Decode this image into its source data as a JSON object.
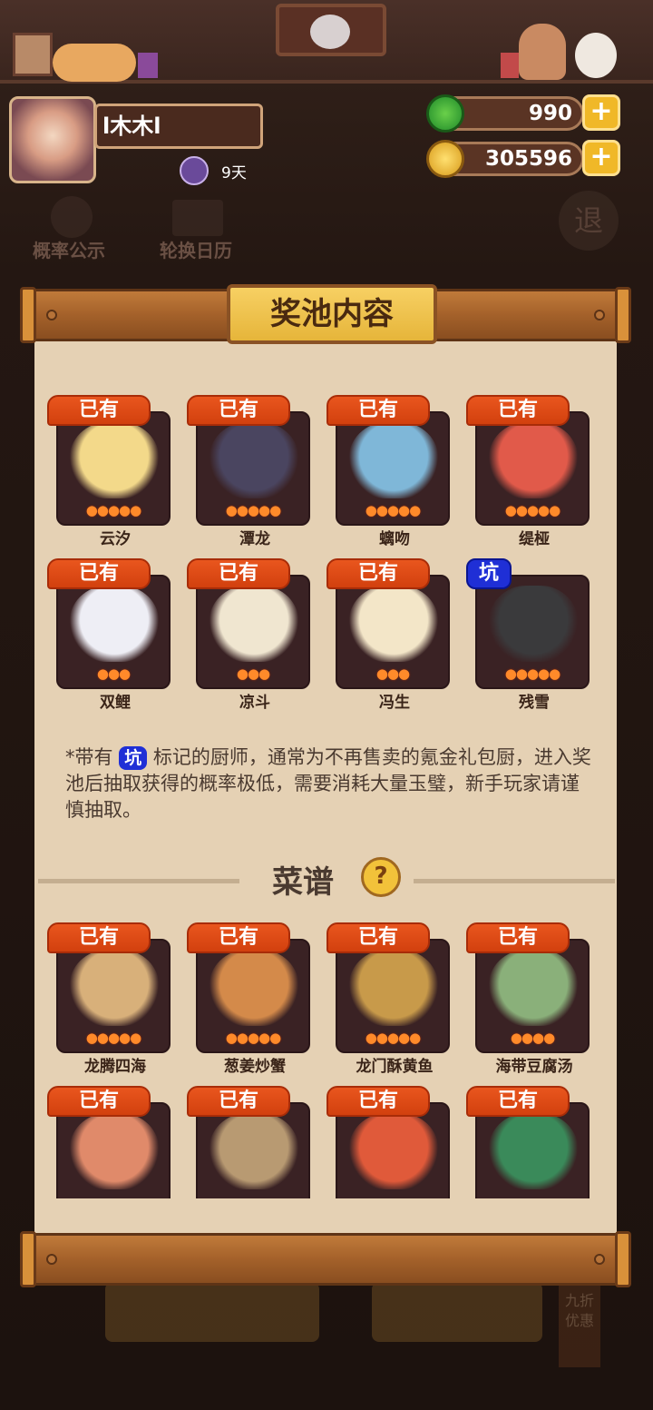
{
  "player": {
    "name": "l木木l",
    "days": "9天"
  },
  "resources": {
    "jade": "990",
    "coins": "305596",
    "plus": "+"
  },
  "background": {
    "prob_label": "概率公示",
    "calendar_label": "轮换日历",
    "exit_label": "退",
    "discount_label": "九折优惠"
  },
  "panel": {
    "title": "奖池内容",
    "recipes_title": "菜谱",
    "help": "?"
  },
  "chefs": [
    {
      "badge": "已有",
      "name": "云汐",
      "stars": 5
    },
    {
      "badge": "已有",
      "name": "潭龙",
      "stars": 5
    },
    {
      "badge": "已有",
      "name": "螭吻",
      "stars": 5
    },
    {
      "badge": "已有",
      "name": "缇桠",
      "stars": 5
    },
    {
      "badge": "已有",
      "name": "双鲤",
      "stars": 3
    },
    {
      "badge": "已有",
      "name": "凉斗",
      "stars": 3
    },
    {
      "badge": "已有",
      "name": "冯生",
      "stars": 3
    },
    {
      "badge": "坑",
      "name": "残雪",
      "stars": 5
    }
  ],
  "note": {
    "prefix": "*带有",
    "badge": "坑",
    "text": "标记的厨师，通常为不再售卖的氪金礼包厨，进入奖池后抽取获得的概率极低，需要消耗大量玉璧，新手玩家请谨慎抽取。"
  },
  "recipes": [
    {
      "badge": "已有",
      "name": "龙腾四海",
      "stars": 5
    },
    {
      "badge": "已有",
      "name": "葱姜炒蟹",
      "stars": 5
    },
    {
      "badge": "已有",
      "name": "龙门酥黄鱼",
      "stars": 5
    },
    {
      "badge": "已有",
      "name": "海带豆腐汤",
      "stars": 4
    },
    {
      "badge": "已有",
      "name": "",
      "stars": 0
    },
    {
      "badge": "已有",
      "name": "",
      "stars": 0
    },
    {
      "badge": "已有",
      "name": "",
      "stars": 0
    },
    {
      "badge": "已有",
      "name": "",
      "stars": 0
    }
  ],
  "colors": {
    "owned_badge": "#d9481a",
    "rare_badge": "#1f2fd6",
    "paper": "#e5d1b4",
    "title_plate": "#f0c44a"
  }
}
